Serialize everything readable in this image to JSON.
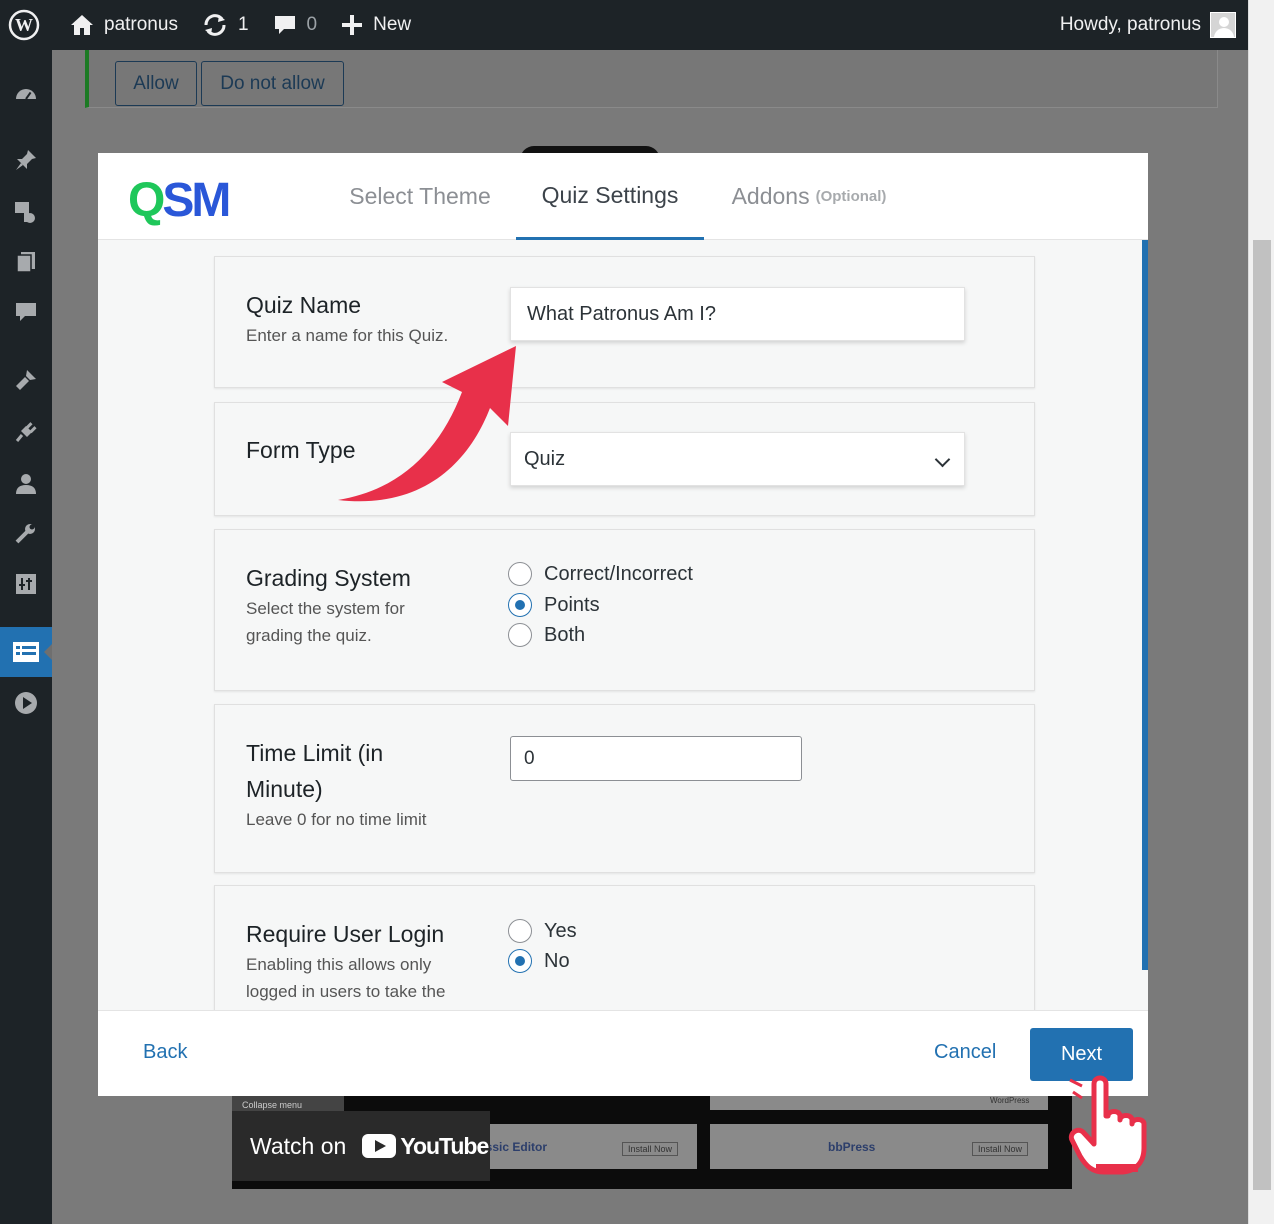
{
  "admin_bar": {
    "site_name": "patronus",
    "updates_count": "1",
    "comments_count": "0",
    "new_label": "New",
    "howdy": "Howdy, patronus"
  },
  "sidebar": {
    "icons": [
      "dashboard-icon",
      "pin-icon",
      "media-icon",
      "pages-icon",
      "comments-icon",
      "appearance-icon",
      "plugins-icon",
      "users-icon",
      "tools-icon",
      "settings-icon",
      "quiz-icon",
      "play-icon"
    ]
  },
  "notice": {
    "allow_label": "Allow",
    "deny_label": "Do not allow"
  },
  "modal": {
    "logo": {
      "part1": "Q",
      "part2": "SM"
    },
    "tabs": [
      {
        "label": "Select Theme",
        "active": false
      },
      {
        "label": "Quiz Settings",
        "active": true
      },
      {
        "label": "Addons",
        "suffix": "(Optional)",
        "active": false
      }
    ],
    "fields": {
      "quiz_name": {
        "title": "Quiz Name",
        "description": "Enter a name for this Quiz.",
        "value": "What Patronus Am I?"
      },
      "form_type": {
        "title": "Form Type",
        "value": "Quiz"
      },
      "grading": {
        "title": "Grading System",
        "description": "Select the system for grading the quiz.",
        "options": [
          "Correct/Incorrect",
          "Points",
          "Both"
        ],
        "selected": "Points"
      },
      "time_limit": {
        "title_line1": "Time Limit (in",
        "title_line2": "Minute)",
        "description": "Leave 0 for no time limit",
        "value": "0"
      },
      "require_login": {
        "title": "Require User Login",
        "description": "Enabling this allows only logged in users to take the",
        "options": [
          "Yes",
          "No"
        ],
        "selected": "No"
      }
    },
    "footer": {
      "back_label": "Back",
      "cancel_label": "Cancel",
      "next_label": "Next"
    }
  },
  "video": {
    "watch_on": "Watch on",
    "youtube": "YouTube",
    "collapse_menu": "Collapse menu",
    "classic_editor": "assic Editor",
    "install_now": "Install Now",
    "wordpress": "WordPress",
    "bbpress": "bbPress"
  },
  "colors": {
    "accent": "#2271b1",
    "admin_bg": "#1d2327",
    "arrow": "#e8304a",
    "logo_green": "#1fc75a",
    "logo_blue": "#2a57d8"
  }
}
